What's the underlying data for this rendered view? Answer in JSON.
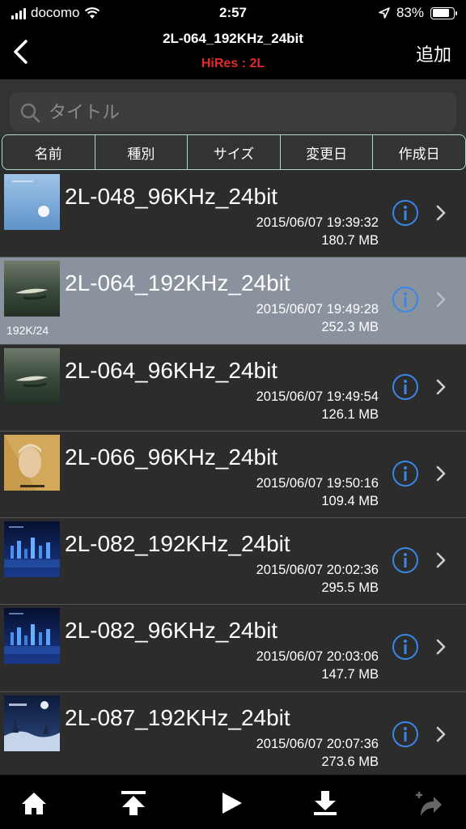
{
  "status_bar": {
    "carrier": "docomo",
    "time": "2:57",
    "battery_percent": "83%",
    "battery_level": 0.83
  },
  "nav": {
    "title": "2L-064_192KHz_24bit",
    "subtitle": "HiRes : 2L",
    "add_label": "追加",
    "back_icon": "chevron-left-icon"
  },
  "search": {
    "placeholder": "タイトル",
    "value": ""
  },
  "sort": {
    "options": [
      "名前",
      "種別",
      "サイズ",
      "変更日",
      "作成日"
    ]
  },
  "files": [
    {
      "title": "2L-048_96KHz_24bit",
      "date": "2015/06/07 19:39:32",
      "size": "180.7 MB",
      "thumb": "blue-moon",
      "caption": "",
      "selected": false
    },
    {
      "title": "2L-064_192KHz_24bit",
      "date": "2015/06/07 19:49:28",
      "size": "252.3 MB",
      "thumb": "green-water",
      "caption": "192K/24",
      "selected": true
    },
    {
      "title": "2L-064_96KHz_24bit",
      "date": "2015/06/07 19:49:54",
      "size": "126.1 MB",
      "thumb": "green-water",
      "caption": "",
      "selected": false
    },
    {
      "title": "2L-066_96KHz_24bit",
      "date": "2015/06/07 19:50:16",
      "size": "109.4 MB",
      "thumb": "gold-portrait",
      "caption": "",
      "selected": false
    },
    {
      "title": "2L-082_192KHz_24bit",
      "date": "2015/06/07 20:02:36",
      "size": "295.5 MB",
      "thumb": "city-night",
      "caption": "",
      "selected": false
    },
    {
      "title": "2L-082_96KHz_24bit",
      "date": "2015/06/07 20:03:06",
      "size": "147.7 MB",
      "thumb": "city-night",
      "caption": "",
      "selected": false
    },
    {
      "title": "2L-087_192KHz_24bit",
      "date": "2015/06/07 20:07:36",
      "size": "273.6 MB",
      "thumb": "winter-night",
      "caption": "",
      "selected": false
    }
  ],
  "tab_bar": {
    "icons": [
      "home-icon",
      "move-to-top-icon",
      "play-icon",
      "download-icon",
      "share-add-icon"
    ]
  },
  "colors": {
    "accent_blue": "#3a86e6",
    "subtitle_red": "#e22a2a",
    "segment_border": "#aed9c8",
    "selected_row": "#8a929d"
  }
}
